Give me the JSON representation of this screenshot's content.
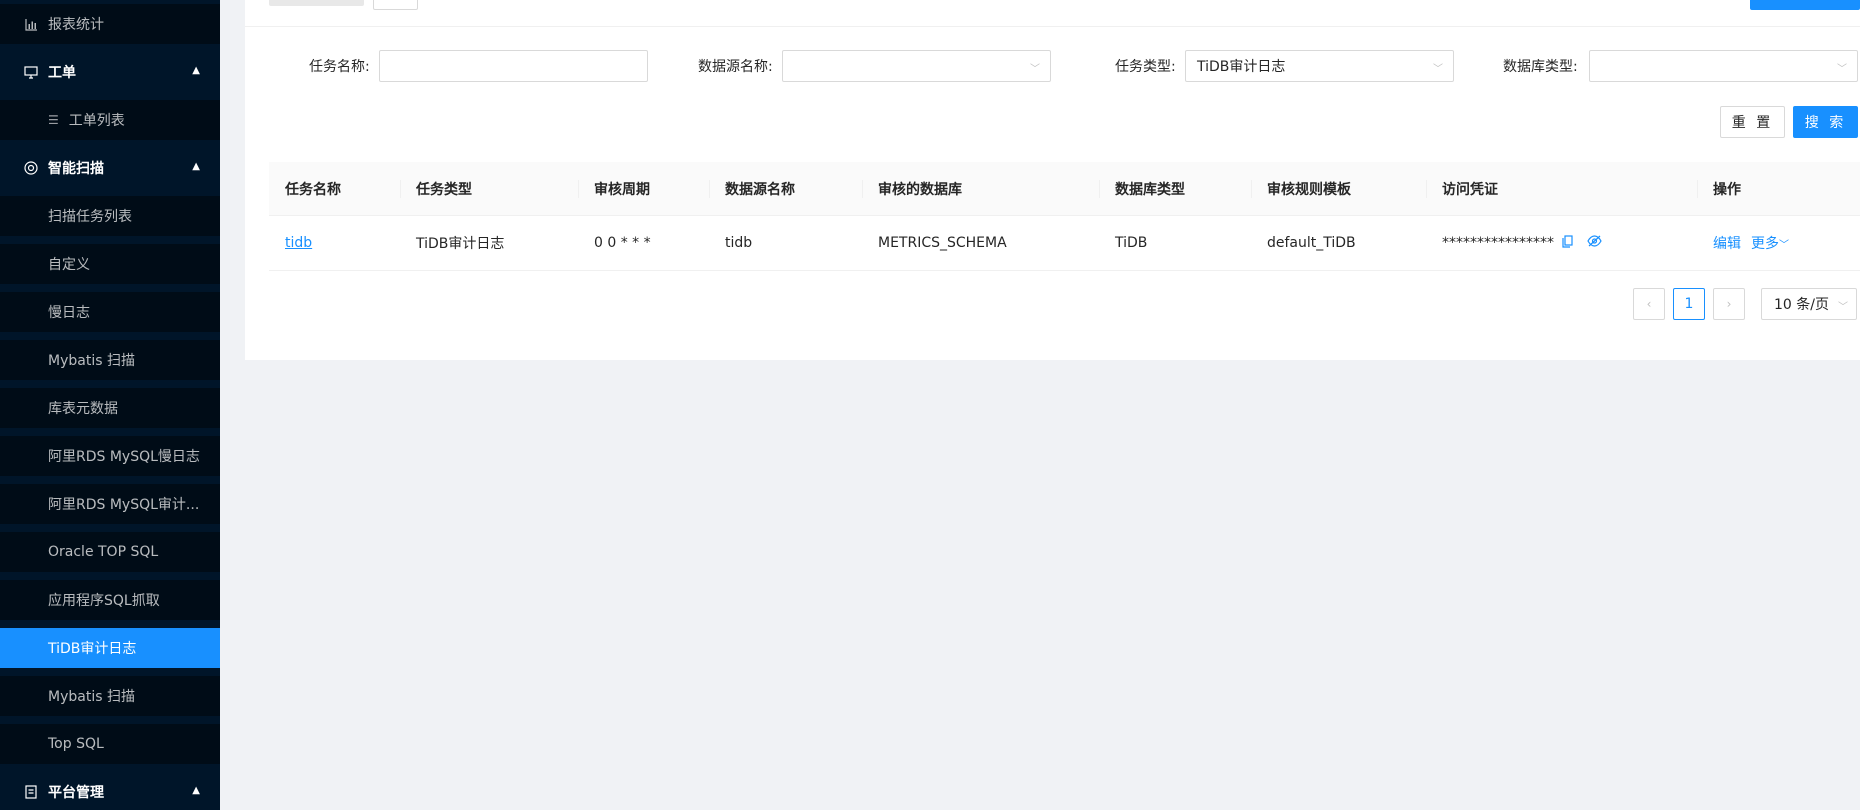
{
  "sidebar": {
    "report_stats": "报表统计",
    "workorder_group": "工单",
    "workorder_list": "工单列表",
    "smart_scan_group": "智能扫描",
    "scan_items": [
      "扫描任务列表",
      "自定义",
      "慢日志",
      "Mybatis 扫描",
      "库表元数据",
      "阿里RDS MySQL慢日志",
      "阿里RDS MySQL审计...",
      "Oracle TOP SQL",
      "应用程序SQL抓取",
      "TiDB审计日志",
      "Mybatis 扫描",
      "Top SQL"
    ],
    "active_item": "TiDB审计日志",
    "platform_group": "平台管理"
  },
  "filters": {
    "task_name_label": "任务名称:",
    "task_name_value": "",
    "datasource_label": "数据源名称:",
    "datasource_value": "",
    "task_type_label": "任务类型:",
    "task_type_value": "TiDB审计日志",
    "db_type_label": "数据库类型:",
    "db_type_value": ""
  },
  "buttons": {
    "reset": "重 置",
    "search": "搜 索"
  },
  "table": {
    "headers": [
      "任务名称",
      "任务类型",
      "审核周期",
      "数据源名称",
      "审核的数据库",
      "数据库类型",
      "审核规则模板",
      "访问凭证",
      "操作"
    ],
    "rows": [
      {
        "task_name": "tidb",
        "task_type": "TiDB审计日志",
        "cycle": "0 0 * * *",
        "datasource": "tidb",
        "database": "METRICS_SCHEMA",
        "db_type": "TiDB",
        "rule_template": "default_TiDB",
        "credential": "****************",
        "edit": "编辑",
        "more": "更多"
      }
    ]
  },
  "pagination": {
    "current_page": "1",
    "page_size": "10 条/页"
  }
}
